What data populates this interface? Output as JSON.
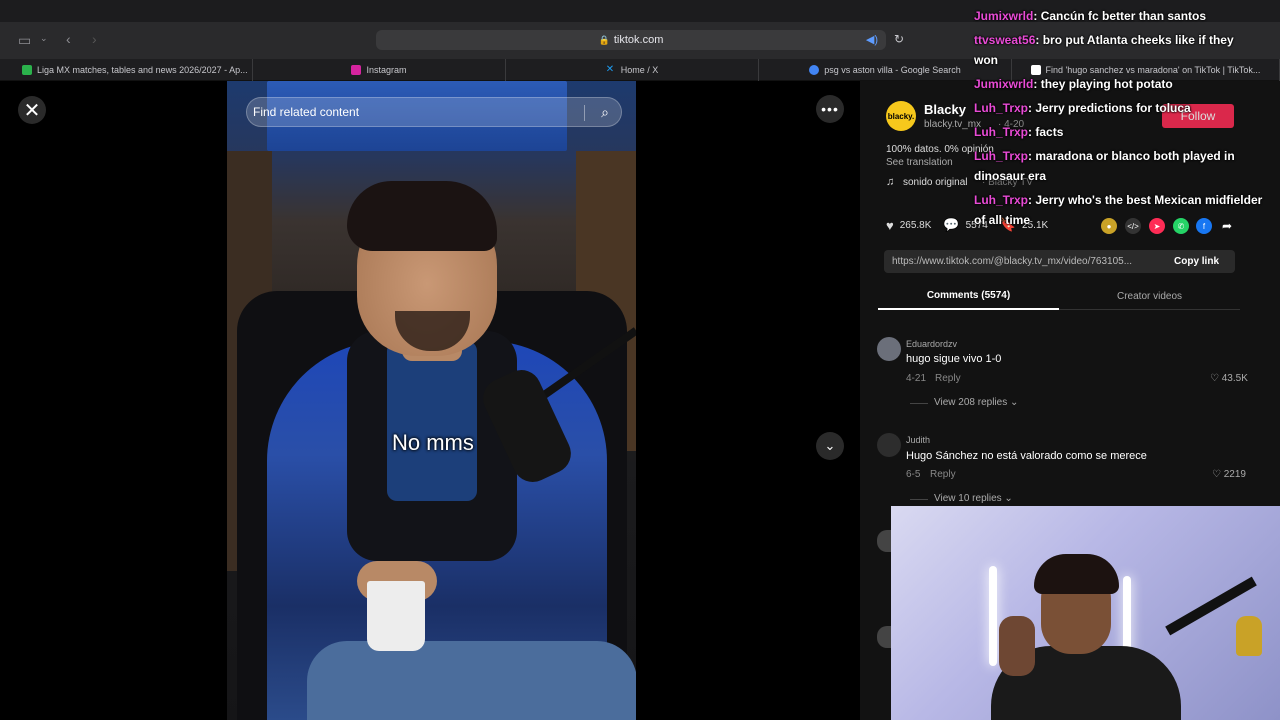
{
  "browser": {
    "url": "tiktok.com",
    "tabs": [
      {
        "label": "Liga MX matches, tables and news 2026/2027 - Ap...",
        "color": "#2bb24c"
      },
      {
        "label": "Instagram",
        "color": "#d6249f"
      },
      {
        "label": "Home / X",
        "color": "#1d9bf0"
      },
      {
        "label": "psg vs aston villa - Google Search",
        "color": "#4285f4"
      },
      {
        "label": "Find 'hugo sanchez vs maradona' on TikTok | TikTok...",
        "color": "#fff"
      }
    ]
  },
  "video": {
    "search_placeholder": "Find related content",
    "caption": "No mms"
  },
  "author": {
    "avatar_text": "blacky.",
    "name": "Blacky",
    "handle": "blacky.tv_mx",
    "date": "· 4-20",
    "follow_label": "Follow",
    "description": "100% datos. 0% opinión",
    "see_translation": "See translation",
    "music": "sonido original",
    "music_creator": "· Blacky TV"
  },
  "actions": {
    "likes": "265.8K",
    "comments": "5574",
    "saves": "25.1K"
  },
  "link": {
    "url": "https://www.tiktok.com/@blacky.tv_mx/video/763105...",
    "copy_label": "Copy link"
  },
  "tabs": {
    "comments": "Comments (5574)",
    "creator": "Creator videos"
  },
  "comments": [
    {
      "user": "Eduardordzv",
      "text": "hugo sigue vivo 1-0",
      "date": "4-21",
      "reply": "Reply",
      "likes": "43.5K",
      "view": "View 208 replies"
    },
    {
      "user": "Judith",
      "text": "Hugo Sánchez no está valorado como se merece",
      "date": "6-5",
      "reply": "Reply",
      "likes": "2219",
      "view": "View 10 replies"
    }
  ],
  "chat": [
    {
      "user": "Jumixwrld",
      "sep": ": ",
      "msg": "Cancún fc better than santos"
    },
    {
      "user": "ttvsweat56",
      "sep": ": ",
      "msg": "bro put Atlanta cheeks like if they"
    },
    {
      "user": "",
      "sep": "",
      "msg": "won"
    },
    {
      "user": "Jumixwrld",
      "sep": ": ",
      "msg": "they playing hot potato"
    },
    {
      "user": "Luh_Trxp",
      "sep": ": ",
      "msg": "Jerry predictions for toluca"
    },
    {
      "user": "Luh_Trxp",
      "sep": ": ",
      "msg": "facts"
    },
    {
      "user": "Luh_Trxp",
      "sep": ": ",
      "msg": "maradona or blanco both played in"
    },
    {
      "user": "",
      "sep": "",
      "msg": "dinosaur era"
    },
    {
      "user": "Luh_Trxp",
      "sep": ": ",
      "msg": "Jerry who's the best Mexican midfielder"
    },
    {
      "user": "",
      "sep": "",
      "msg": "of all time"
    }
  ]
}
